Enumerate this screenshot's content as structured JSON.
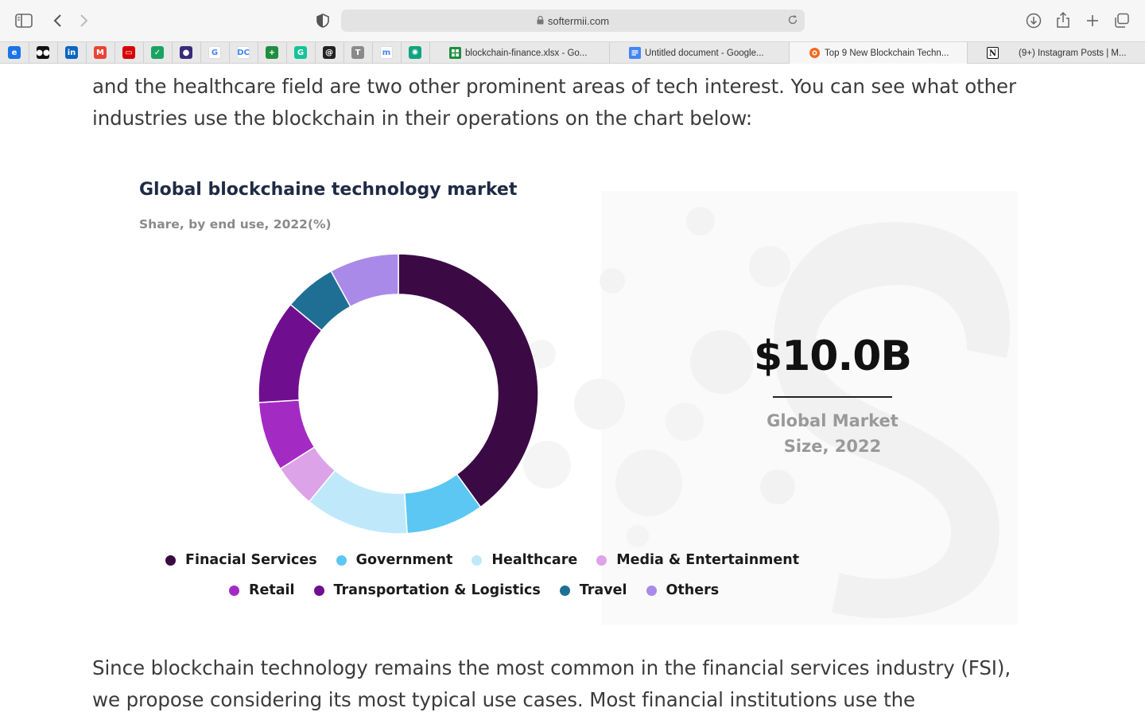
{
  "browser": {
    "url": "softermii.com",
    "tabs": [
      {
        "label": "blockchain-finance.xlsx - Go...",
        "icon": "google-sheets-icon",
        "color": "#1e8e3e"
      },
      {
        "label": "Untitled document - Google...",
        "icon": "google-docs-icon",
        "color": "#4285f4"
      },
      {
        "label": "Top 9 New Blockchain Techn...",
        "icon": "softermii-icon",
        "color": "#f26b1d"
      },
      {
        "label": "(9+) Instagram Posts | M...",
        "icon": "notion-icon",
        "color": "#111111"
      }
    ],
    "pinned": [
      {
        "icon": "edge-icon",
        "color": "#1a73e8",
        "glyph": "e"
      },
      {
        "icon": "medium-icon",
        "color": "#111111",
        "glyph": "●●"
      },
      {
        "icon": "linkedin-icon",
        "color": "#0a66c2",
        "glyph": "in"
      },
      {
        "icon": "gmail-icon",
        "color": "#ea4335",
        "glyph": "M"
      },
      {
        "icon": "red-app-icon",
        "color": "#d50000",
        "glyph": "▭"
      },
      {
        "icon": "check-app-icon",
        "color": "#1aa260",
        "glyph": "✓"
      },
      {
        "icon": "purple-app-icon",
        "color": "#3b2a7a",
        "glyph": "●"
      },
      {
        "icon": "google-icon",
        "color": "#ffffff",
        "glyph": "G"
      },
      {
        "icon": "dc-icon",
        "color": "#ffffff",
        "glyph": "DC"
      },
      {
        "icon": "sheets-icon",
        "color": "#1e8e3e",
        "glyph": "+"
      },
      {
        "icon": "grammarly-icon",
        "color": "#15c39a",
        "glyph": "G"
      },
      {
        "icon": "at-icon",
        "color": "#222222",
        "glyph": "@"
      },
      {
        "icon": "t-app-icon",
        "color": "#8a8a8a",
        "glyph": "T"
      },
      {
        "icon": "monday-icon",
        "color": "#ffffff",
        "glyph": "m"
      },
      {
        "icon": "chatgpt-icon",
        "color": "#10a37f",
        "glyph": "✺"
      }
    ]
  },
  "article": {
    "intro_lines": [
      "and the healthcare field are two other prominent areas of tech interest. You can see what other",
      "industries use the blockchain in their operations on the chart below:"
    ],
    "outro_lines": [
      "Since blockchain technology remains the most common in the financial services industry (FSI),",
      "we propose considering its most typical use cases. Most financial institutions use the"
    ]
  },
  "infographic": {
    "title": "Global blockchaine technology market",
    "subtitle": "Share, by end use, 2022(%)",
    "big_value": "$10.0B",
    "caption_line1": "Global Market",
    "caption_line2": "Size, 2022"
  },
  "chart_data": {
    "type": "pie",
    "title": "Global blockchaine technology market",
    "subtitle": "Share, by end use, 2022(%)",
    "donut": true,
    "categories": [
      "Finacial Services",
      "Government",
      "Healthcare",
      "Media & Entertainment",
      "Retail",
      "Transportation & Logistics",
      "Travel",
      "Others"
    ],
    "values": [
      40,
      9,
      12,
      5,
      8,
      12,
      6,
      8
    ],
    "colors": [
      "#3b0a45",
      "#5bc7f2",
      "#bfe9fa",
      "#dca3e8",
      "#a32bc4",
      "#6f0f8f",
      "#1f6f94",
      "#a98ae8"
    ],
    "legend_position": "bottom"
  }
}
